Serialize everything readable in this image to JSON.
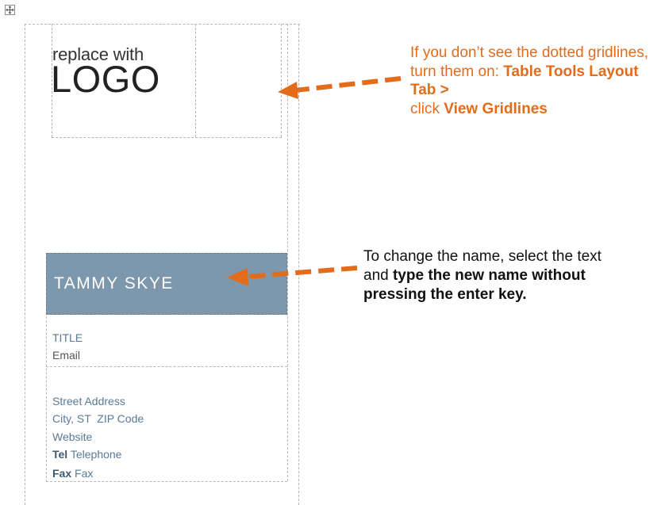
{
  "logo": {
    "line1": "replace with",
    "line2": "LOGO"
  },
  "card": {
    "name": "TAMMY SKYE",
    "title": "TITLE",
    "email": "Email",
    "street": "Street Address",
    "city": "City, ST  ZIP Code",
    "website": "Website",
    "tel_label": "Tel",
    "tel_value": "Telephone",
    "fax_label": "Fax",
    "fax_value": "Fax"
  },
  "notes": {
    "gridlines_1": "If you don’t see the dotted gridlines, turn them on: ",
    "gridlines_2": "Table Tools Layout Tab >",
    "gridlines_3": " click ",
    "gridlines_4": "View Gridlines",
    "name_1": "To change the name, select the text and ",
    "name_2": "type the new name without pressing the enter key."
  },
  "colors": {
    "accent": "#E36C1A",
    "name_bar": "#7D97AD",
    "text_blue": "#5B7A96"
  }
}
